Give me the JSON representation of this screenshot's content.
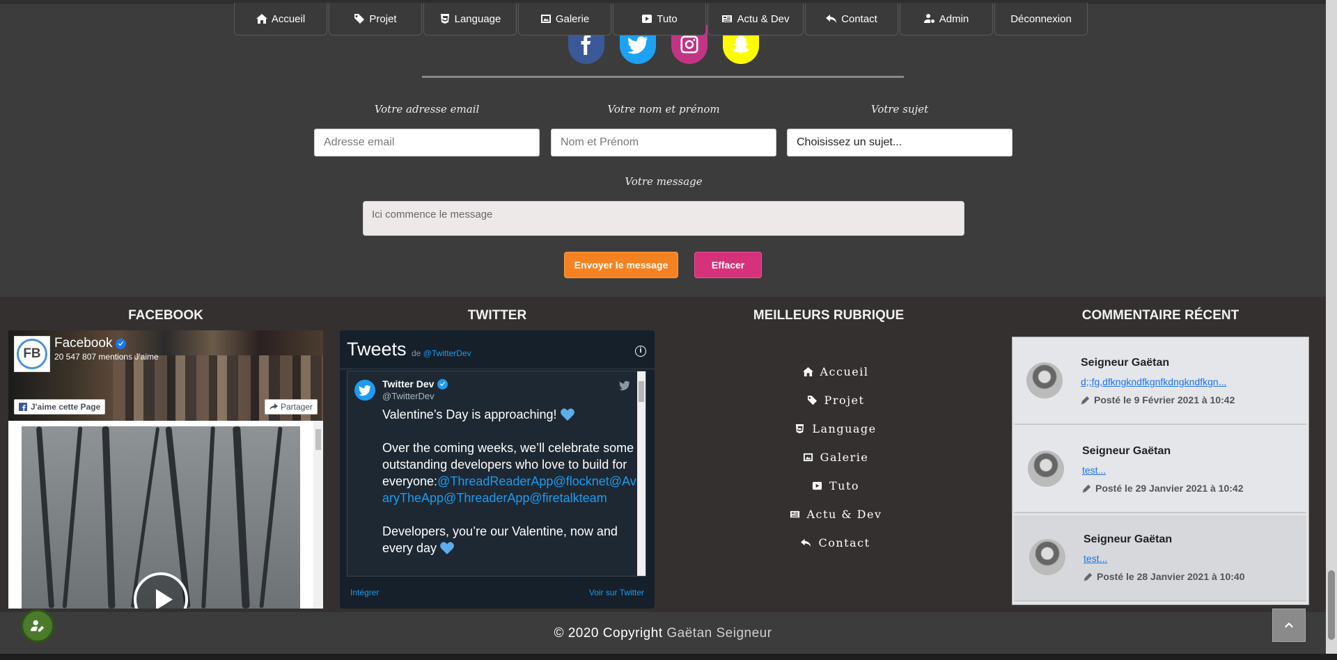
{
  "nav": [
    {
      "label": "Accueil",
      "icon": "home-icon"
    },
    {
      "label": "Projet",
      "icon": "tag-icon"
    },
    {
      "label": "Language",
      "icon": "html5-icon"
    },
    {
      "label": "Galerie",
      "icon": "image-icon"
    },
    {
      "label": "Tuto",
      "icon": "youtube-icon"
    },
    {
      "label": "Actu & Dev",
      "icon": "newspaper-icon"
    },
    {
      "label": "Contact",
      "icon": "reply-icon"
    },
    {
      "label": "Admin",
      "icon": "user-cog-icon"
    },
    {
      "label": "Déconnexion",
      "icon": ""
    }
  ],
  "social": [
    {
      "name": "facebook",
      "color": "#3b5998"
    },
    {
      "name": "twitter",
      "color": "#1da1f2"
    },
    {
      "name": "instagram",
      "color": "#c13584"
    },
    {
      "name": "snapchat",
      "color": "#fffc00"
    }
  ],
  "form": {
    "email_label": "Votre adresse email",
    "email_placeholder": "Adresse email",
    "name_label": "Votre nom et prénom",
    "name_placeholder": "Nom et Prénom",
    "subject_label": "Votre sujet",
    "subject_value": "Choisissez un sujet...",
    "message_label": "Votre message",
    "message_placeholder": "Ici commence le message",
    "send_label": "Envoyer le message",
    "clear_label": "Effacer",
    "send_color": "#f58220",
    "clear_color": "#d6317b"
  },
  "footer": {
    "facebook_title": "FACEBOOK",
    "twitter_title": "TWITTER",
    "rubrique_title": "MEILLEURS RUBRIQUE",
    "comments_title": "COMMENTAIRE RÉCENT"
  },
  "facebook_widget": {
    "page_name": "Facebook",
    "logo_text": "FB",
    "mentions": "20 547 807 mentions J'aime",
    "like_label": "J'aime cette Page",
    "share_label": "Partager"
  },
  "twitter_widget": {
    "title": "Tweets",
    "de": "de",
    "handle_link": "@TwitterDev",
    "user": "Twitter Dev",
    "handle": "@TwitterDev",
    "line1": "Valentine’s Day is approaching!",
    "line2": "Over the coming weeks, we’ll celebrate some outstanding developers who love to build for everyone:",
    "mentions": "@ThreadReaderApp@flocknet@AviaryTheApp@ThreaderApp@firetalkteam",
    "line3": "Developers, you’re our Valentine, now and every day",
    "embed_label": "Intégrer",
    "view_label": "Voir sur Twitter"
  },
  "rubriques": [
    {
      "label": "Accueil",
      "icon": "home-icon"
    },
    {
      "label": "Projet",
      "icon": "tag-icon"
    },
    {
      "label": "Language",
      "icon": "html5-icon"
    },
    {
      "label": "Galerie",
      "icon": "image-icon"
    },
    {
      "label": "Tuto",
      "icon": "youtube-icon"
    },
    {
      "label": "Actu & Dev",
      "icon": "newspaper-icon"
    },
    {
      "label": "Contact",
      "icon": "reply-icon"
    }
  ],
  "comments": [
    {
      "author": "Seigneur Gaëtan",
      "text": "d;;fg,dfkngkndfkgnfkdngkndfkgn...",
      "date": "Posté le 9 Février 2021 à 10:42"
    },
    {
      "author": "Seigneur Gaëtan",
      "text": "test...",
      "date": "Posté le 29 Janvier 2021 à 10:42"
    },
    {
      "author": "Seigneur Gaëtan",
      "text": "test...",
      "date": "Posté le 28 Janvier 2021 à 10:40"
    }
  ],
  "copyright": {
    "prefix": "© 2020 Copyright",
    "name": "Gaëtan Seigneur"
  }
}
